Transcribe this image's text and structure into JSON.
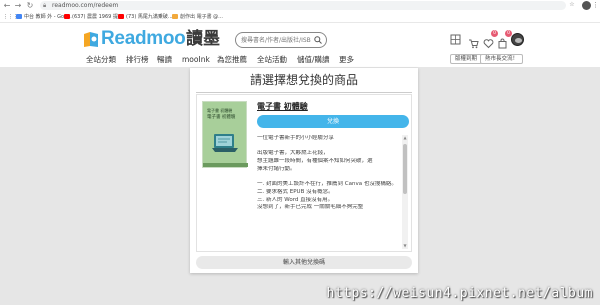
{
  "browser": {
    "url": "readmoo.com/redeem",
    "bookmarks": [
      {
        "label": "中台 教師 外 - Goo...",
        "color": "#4285f4"
      },
      {
        "label": "(637) 農農 1969 提...",
        "color": "#ff0000"
      },
      {
        "label": "(73) 馬尾九滿乗破...",
        "color": "#ff0000"
      },
      {
        "label": "創作出 電子書 @...",
        "color": "#f2a93b"
      }
    ]
  },
  "header": {
    "logo_text": "Readmoo",
    "logo_chinese": "讀墨",
    "search_placeholder": "搜尋書名/作者/出版社/ISBN",
    "cart_badge": "0",
    "favorites_badge": "0",
    "nav": [
      "全站分類",
      "排行榜",
      "暢讀",
      "mooInk",
      "為您推薦",
      "全站活動",
      "儲值/購讀",
      "更多"
    ],
    "action_buttons": [
      "版權到期",
      "熱市長交流！"
    ]
  },
  "card": {
    "title": "請選擇想兌換的商品",
    "product_name": "電子書 初體驗",
    "redeem_label": "兌換",
    "cover_tag": "電子書 初體驗",
    "cover_subtitle": "電子書 初體驗",
    "description": [
      "一位電子書新手的小小經驗分享",
      "",
      "出版電子書，大夥燃上花錢，",
      "想主題難一段時間，有種個案不知如何突破，選",
      "擇未付諸行動。",
      "",
      "一. 封面的美工設計不在行，推薦到 Canva 也沒搜構絡。",
      "二. 要求格式 EPUB 沒有概念。",
      "三. 新人的 Word 直接沒有用。",
      "沒想到了，新手已完成 一關關毛細不夠完整"
    ],
    "other_label": "輸入其他兌換碼"
  },
  "watermark": "https://weisun4.pixnet.net/album",
  "colors": {
    "brand": "#3fa9e0",
    "button": "#44b5ea",
    "badge": "#e65a72"
  }
}
